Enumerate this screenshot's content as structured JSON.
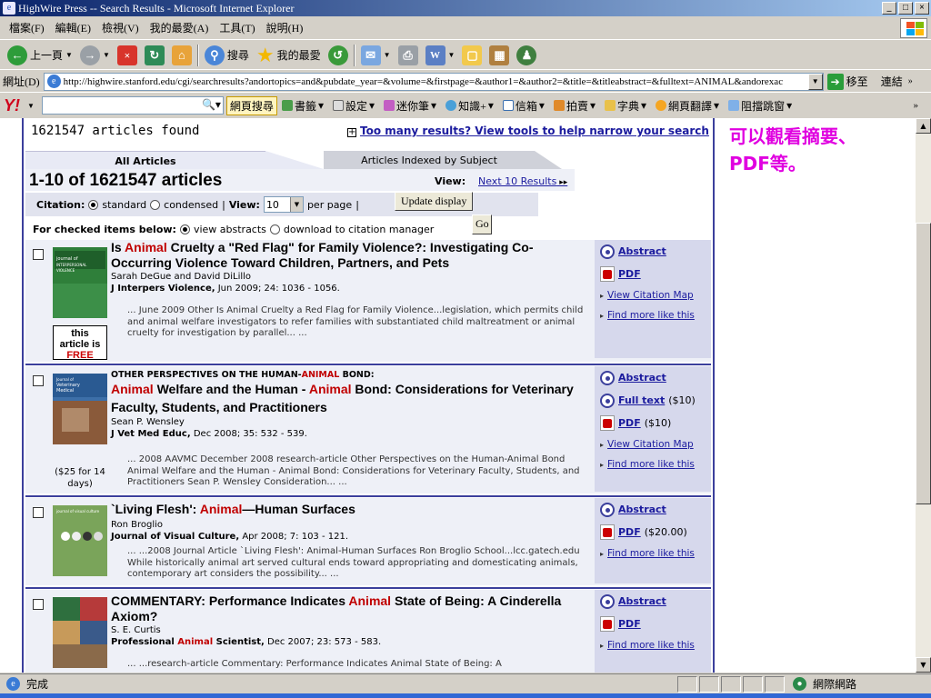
{
  "window": {
    "title": "HighWire Press -- Search Results - Microsoft Internet Explorer",
    "min": "_",
    "max": "□",
    "close": "×"
  },
  "menu": [
    "檔案(F)",
    "編輯(E)",
    "檢視(V)",
    "我的最愛(A)",
    "工具(T)",
    "說明(H)"
  ],
  "toolbar": {
    "back": "上一頁",
    "search": "搜尋",
    "favorites": "我的最愛"
  },
  "address": {
    "label": "網址(D)",
    "url": "http://highwire.stanford.edu/cgi/searchresults?andortopics=and&pubdate_year=&volume=&firstpage=&author1=&author2=&title=&titleabstract=&fulltext=ANIMAL&andorexac",
    "go": "移至",
    "links": "連結"
  },
  "yahoo": {
    "logo": "Y!",
    "search_btn": "網頁搜尋",
    "items": [
      "書籤",
      "設定",
      "迷你筆",
      "知識+",
      "信箱",
      "拍賣",
      "字典",
      "網頁翻譯",
      "阻擋跳窗"
    ]
  },
  "page": {
    "found": "1621547 articles found",
    "too_many": "Too many results? View tools to help narrow your search",
    "tab_all": "All Articles",
    "tab_subject": "Articles Indexed by Subject",
    "range": "1-10 of 1621547 articles",
    "view_label": "View:",
    "next": "Next 10 Results",
    "citation_label": "Citation:",
    "standard": "standard",
    "condensed": "condensed",
    "view2": "View:",
    "per_page_value": "10",
    "per_page": "per page",
    "update": "Update display",
    "checked_label": "For checked items below:",
    "view_abstracts": "view abstracts",
    "download_cit": "download to citation manager",
    "go": "Go"
  },
  "articles": [
    {
      "title_pre": "Is ",
      "title_hl": "Animal",
      "title_post": " Cruelty a \"Red Flag\" for Family Violence?: Investigating Co-Occurring Violence Toward Children, Partners, and Pets",
      "authors": "Sarah DeGue and David DiLillo",
      "journal": "J Interpers Violence,",
      "cite": " Jun 2009; 24: 1036 - 1056.",
      "snippet": "... June 2009 Other Is Animal Cruelty a Red Flag for Family Violence...legislation, which permits child and animal welfare investigators to refer families with substantiated child maltreatment or animal cruelty for investigation by parallel... ...",
      "free_1": "this",
      "free_2": "article is",
      "free_3": "FREE",
      "links": {
        "abstract": "Abstract",
        "pdf": "PDF",
        "citation_map": "View Citation Map",
        "more": "Find more like this"
      }
    },
    {
      "kicker_pre": "OTHER PERSPECTIVES ON THE HUMAN-",
      "kicker_hl": "ANIMAL",
      "kicker_post": " BOND:",
      "t1": "Animal",
      "t2": " Welfare and the Human - ",
      "t3": "Animal",
      "t4": " Bond: Considerations for Veterinary Faculty, Students, and Practitioners",
      "authors": "Sean P. Wensley",
      "journal": "J Vet Med Educ,",
      "cite": " Dec 2008; 35: 532 - 539.",
      "snippet": "... 2008 AAVMC December 2008 research-article Other Perspectives on the Human-Animal Bond Animal Welfare and the Human - Animal Bond: Considerations for Veterinary Faculty, Students, and Practitioners Sean P. Wensley Consideration... ...",
      "price": "($25 for 14 days)",
      "links": {
        "abstract": "Abstract",
        "fulltext": "Full text",
        "fulltext_price": "($10)",
        "pdf": "PDF",
        "pdf_price": "($10)",
        "citation_map": "View Citation Map",
        "more": "Find more like this"
      }
    },
    {
      "title_pre": "`Living Flesh': ",
      "title_hl": "Animal",
      "title_post": "—Human Surfaces",
      "authors": "Ron Broglio",
      "journal": "Journal of Visual Culture,",
      "cite": " Apr 2008; 7: 103 - 121.",
      "snippet": "... ...2008 Journal Article `Living Flesh': Animal-Human Surfaces Ron Broglio School...lcc.gatech.edu While historically animal art served cultural ends toward appropriating and domesticating animals, contemporary art considers the possibility... ...",
      "links": {
        "abstract": "Abstract",
        "pdf": "PDF",
        "pdf_price": "($20.00)",
        "more": "Find more like this"
      }
    },
    {
      "title_pre": "COMMENTARY: Performance Indicates ",
      "title_hl": "Animal",
      "title_post": " State of Being: A Cinderella Axiom?",
      "authors": "S. E. Curtis",
      "journal_pre": "Professional ",
      "journal_hl": "Animal",
      "journal_post": " Scientist,",
      "cite": " Dec 2007; 23: 573 - 583.",
      "snippet": "... ...research-article Commentary: Performance Indicates Animal State of Being: A",
      "links": {
        "abstract": "Abstract",
        "pdf": "PDF",
        "more": "Find more like this"
      }
    }
  ],
  "note": {
    "line1": "可以觀看摘要、",
    "line2": "PDF等。"
  },
  "status": {
    "text": "完成",
    "zone": "網際網路"
  }
}
